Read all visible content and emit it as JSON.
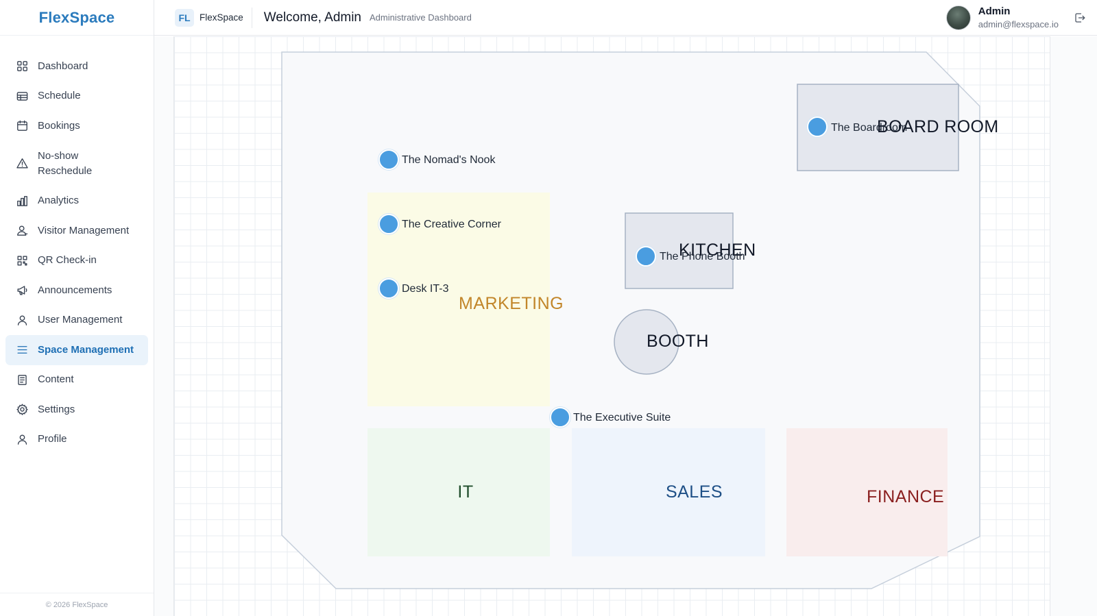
{
  "brand": {
    "name": "FlexSpace"
  },
  "sidebar": {
    "items": [
      {
        "label": "Dashboard",
        "icon": "grid-icon"
      },
      {
        "label": "Schedule",
        "icon": "table-icon"
      },
      {
        "label": "Bookings",
        "icon": "calendar-icon"
      },
      {
        "label": "No-show Reschedule",
        "icon": "warning-icon"
      },
      {
        "label": "Analytics",
        "icon": "bar-chart-icon"
      },
      {
        "label": "Visitor Management",
        "icon": "visitor-icon"
      },
      {
        "label": "QR Check-in",
        "icon": "qr-code-icon"
      },
      {
        "label": "Announcements",
        "icon": "megaphone-icon"
      },
      {
        "label": "User Management",
        "icon": "user-icon"
      },
      {
        "label": "Space Management",
        "icon": "menu-icon",
        "active": true
      },
      {
        "label": "Content",
        "icon": "document-icon"
      },
      {
        "label": "Settings",
        "icon": "gear-icon"
      },
      {
        "label": "Profile",
        "icon": "user-icon"
      }
    ],
    "footer": "© 2026 FlexSpace"
  },
  "header": {
    "workspace_badge": "FL",
    "workspace_name": "FlexSpace",
    "welcome": "Welcome, Admin",
    "subtitle": "Administrative Dashboard",
    "user_name": "Admin",
    "user_email": "admin@flexspace.io"
  },
  "floorplan": {
    "zones": {
      "marketing": {
        "label": "MARKETING",
        "color": "#c2862a",
        "fill": "#fbfbe6"
      },
      "it": {
        "label": "IT",
        "color": "#1f4d2b",
        "fill": "#eef8ef"
      },
      "sales": {
        "label": "SALES",
        "color": "#1e4f86",
        "fill": "#eef4fc"
      },
      "finance": {
        "label": "FINANCE",
        "color": "#8a1f1f",
        "fill": "#f9eded"
      }
    },
    "rooms": {
      "board_room": "BOARD ROOM",
      "kitchen": "KITCHEN",
      "booth": "BOOTH"
    },
    "spaces": {
      "nomads_nook": "The Nomad's Nook",
      "creative_corner": "The Creative Corner",
      "desk_it3": "Desk IT-3",
      "executive_suite": "The Executive Suite",
      "boardroom": "The Boardroom",
      "phone_booth": "The Phone Booth"
    },
    "pin_color": "#4a9de0"
  }
}
